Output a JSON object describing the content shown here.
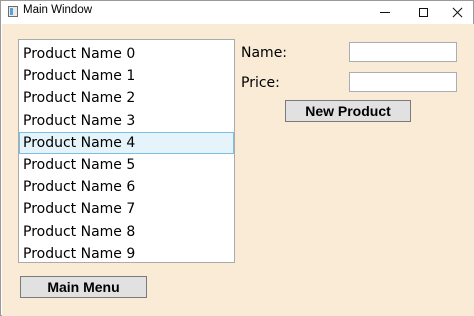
{
  "window": {
    "title": "Main Window"
  },
  "products": [
    "Product Name 0",
    "Product Name 1",
    "Product Name 2",
    "Product Name 3",
    "Product Name 4",
    "Product Name 5",
    "Product Name 6",
    "Product Name 7",
    "Product Name 8",
    "Product Name 9"
  ],
  "selected_index": 4,
  "form": {
    "name_label": "Name:",
    "name_value": "",
    "price_label": "Price:",
    "price_value": "",
    "new_product_button": "New Product"
  },
  "footer": {
    "main_menu_button": "Main Menu"
  },
  "colors": {
    "background": "#faebd7",
    "selection": "#e5f3fb",
    "selection_border": "#7ac0e6",
    "button": "#e1e1e1"
  }
}
